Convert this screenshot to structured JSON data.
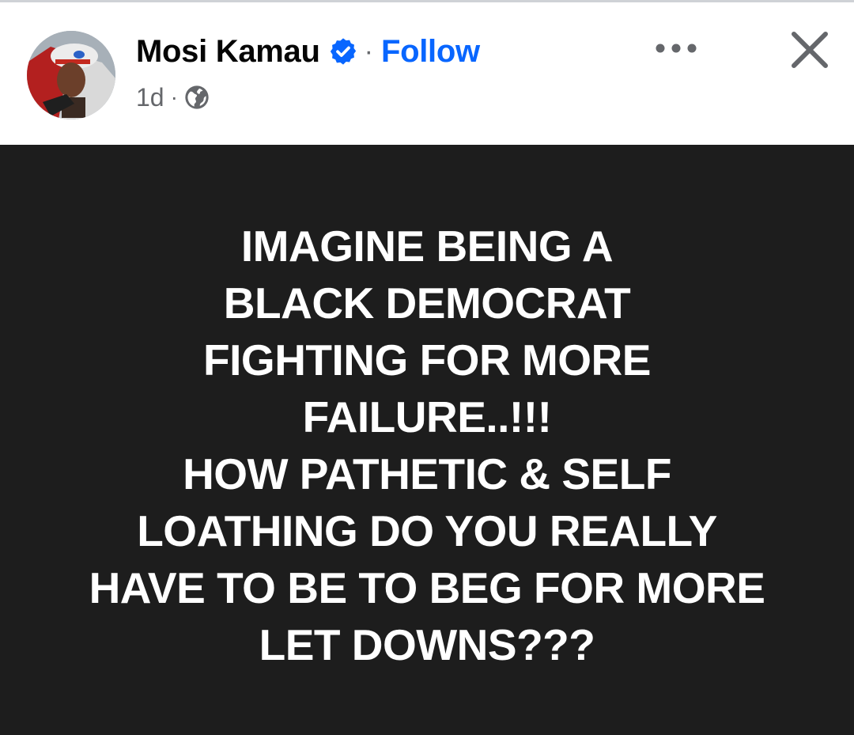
{
  "post": {
    "author": "Mosi Kamau",
    "separator": "·",
    "follow_label": "Follow",
    "timestamp": "1d",
    "meta_separator": "·",
    "audience_icon": "globe-icon",
    "verified_icon": "verified-badge-icon",
    "more_icon": "more-options-icon",
    "close_icon": "close-icon",
    "text_lines": [
      "IMAGINE BEING A",
      "BLACK DEMOCRAT",
      "FIGHTING FOR MORE",
      "FAILURE..!!!",
      "HOW PATHETIC & SELF",
      "LOATHING DO YOU REALLY",
      "HAVE TO BE TO BEG FOR MORE",
      "LET DOWNS???"
    ]
  },
  "colors": {
    "background": "#ffffff",
    "post_background": "#1d1d1d",
    "post_text": "#ffffff",
    "author_text": "#050505",
    "meta_text": "#65676b",
    "accent_blue": "#0866ff"
  }
}
